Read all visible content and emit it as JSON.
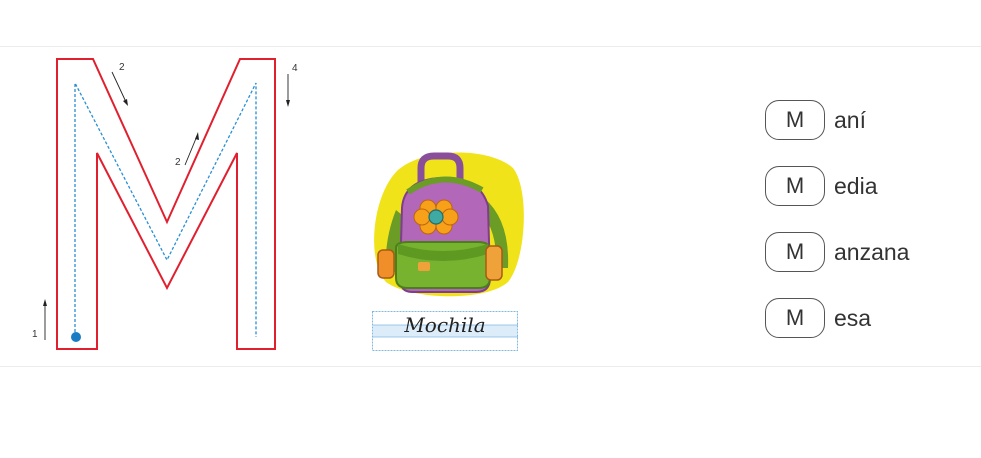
{
  "tracing": {
    "stroke_numbers": [
      "1",
      "2",
      "2",
      "4"
    ],
    "colors": {
      "outline": "#e0202f",
      "guide": "#2a8fd4",
      "start_dot": "#1a7dc4"
    }
  },
  "illustration": {
    "icon": "backpack-icon",
    "word": "Mochila"
  },
  "words": [
    {
      "letter": "M",
      "rest": "aní"
    },
    {
      "letter": "M",
      "rest": "edia"
    },
    {
      "letter": "M",
      "rest": "anzana"
    },
    {
      "letter": "M",
      "rest": "esa"
    }
  ]
}
